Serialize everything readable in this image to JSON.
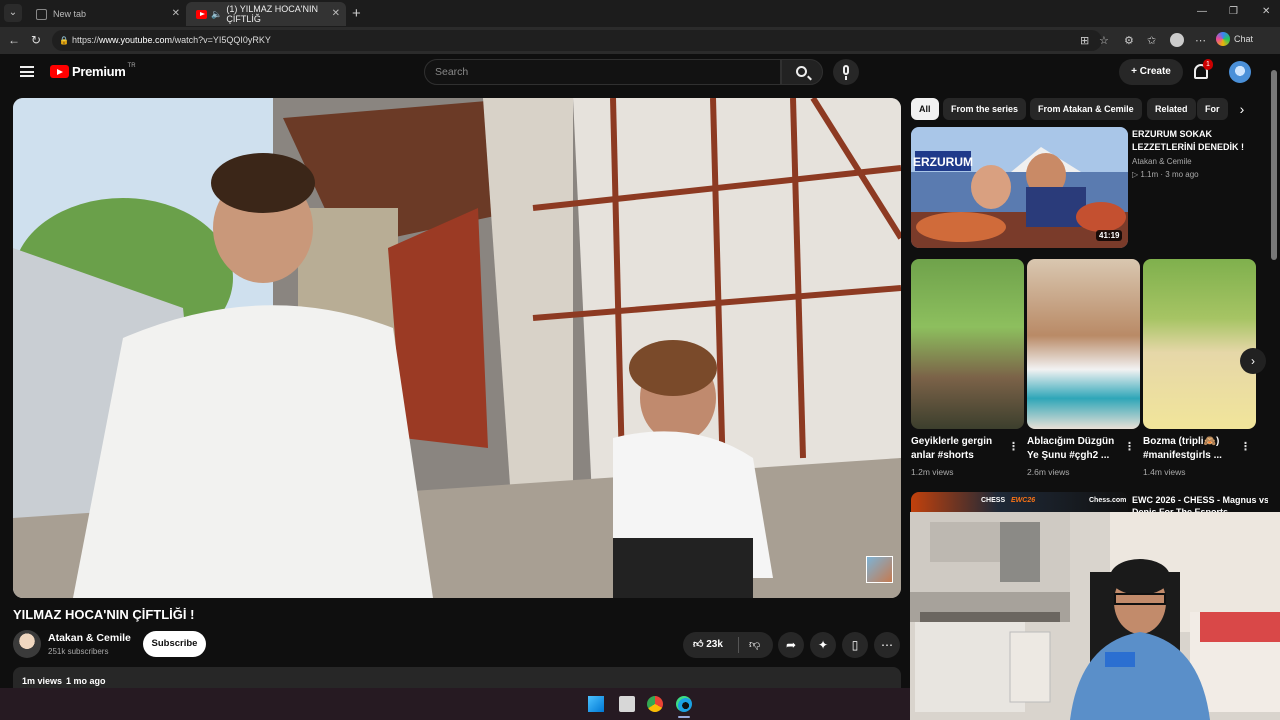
{
  "browser": {
    "tabs": [
      {
        "title": "New tab"
      },
      {
        "title": "(1) YILMAZ HOCA'NIN ÇİFTLİĞ"
      }
    ],
    "url_prefix": "https://",
    "url_host": "www.youtube.com",
    "url_rest": "/watch?v=YI5QQI0yRKY",
    "chat_label": "Chat"
  },
  "youtube": {
    "logo_text": "Premium",
    "logo_region": "TR",
    "search_placeholder": "Search",
    "create_label": "Create",
    "notification_count": "1"
  },
  "video": {
    "title": "YILMAZ HOCA'NIN ÇİFTLİĞİ !",
    "channel": "Atakan & Cemile",
    "subscribers": "251k subscribers",
    "subscribe_label": "Subscribe",
    "likes": "23k",
    "views": "1m views",
    "age": "1 mo ago"
  },
  "chips": [
    "All",
    "From the series",
    "From Atakan & Cemile",
    "Related",
    "For"
  ],
  "recommended": {
    "title": "ERZURUM SOKAK LEZZETLERİNİ DENEDİK !",
    "thumb_text": "ERZURUM",
    "channel": "Atakan & Cemile",
    "meta": "▷ 1.1m · 3 mo ago",
    "duration": "41:19"
  },
  "shorts": [
    {
      "title": "Geyiklerle gergin anlar #shorts",
      "views": "1.2m views"
    },
    {
      "title": "Ablacığım Düzgün Ye Şunu #çgh2 ...",
      "views": "2.6m views"
    },
    {
      "title": "Bozma (tripli🙈) #manifestgirls ...",
      "views": "1.4m views"
    }
  ],
  "recommended2": {
    "title": "EWC 2026 - CHESS - Magnus vs. Denis For The Esports",
    "thumb_label_1": "CHESS",
    "thumb_label_2": "EWC26",
    "thumb_label_3": "Chess.com"
  },
  "colors": {
    "youtube_red": "#ff0000",
    "background": "#0f0f0f",
    "chip_bg": "#272727"
  }
}
